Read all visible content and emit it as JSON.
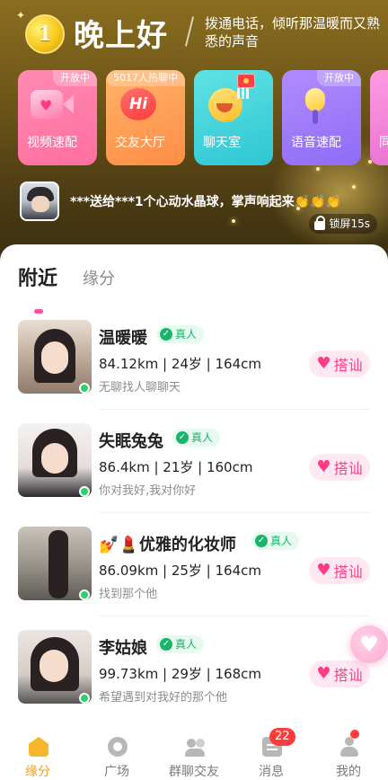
{
  "header": {
    "coin_level": "1",
    "greeting": "晚上好",
    "subtitle": "拨通电话，倾听那温暖而又熟悉的声音"
  },
  "feature_cards": [
    {
      "label": "视频速配",
      "badge": "开放中",
      "icon": "video-camera-heart-icon"
    },
    {
      "label": "交友大厅",
      "badge": "5017人热聊中",
      "icon": "hi-bubble-icon"
    },
    {
      "label": "聊天室",
      "badge": "",
      "icon": "smile-face-icon"
    },
    {
      "label": "语音速配",
      "badge": "开放中",
      "icon": "microphone-icon"
    },
    {
      "label": "同",
      "badge": "",
      "icon": "heart-icon"
    }
  ],
  "gift_marquee": {
    "text": "***送给***1个心动水晶球，掌声响起来👏👏👏"
  },
  "lock_screen": {
    "label": "锁屏15s"
  },
  "tabs": {
    "active": "附近",
    "inactive": "缘分"
  },
  "users": [
    {
      "name": "温暖暖",
      "verified": "真人",
      "stats": "84.12km | 24岁 | 164cm",
      "bio": "无聊找人聊聊天",
      "action": "搭讪",
      "online": true
    },
    {
      "name": "失眠兔兔",
      "verified": "真人",
      "stats": "86.4km | 21岁 | 160cm",
      "bio": "你对我好,我对你好",
      "action": "搭讪",
      "online": true
    },
    {
      "name": "💅💄优雅的化妆师",
      "verified": "真人",
      "stats": "86.09km | 25岁 | 164cm",
      "bio": "找到那个他",
      "action": "搭讪",
      "online": true
    },
    {
      "name": "李姑娘",
      "verified": "真人",
      "stats": "99.73km | 29岁 | 168cm",
      "bio": "希望遇到对我好的那个他",
      "action": "搭讪",
      "online": true
    }
  ],
  "bottom_nav": [
    {
      "label": "缘分",
      "active": true
    },
    {
      "label": "广场",
      "active": false
    },
    {
      "label": "群聊交友",
      "active": false
    },
    {
      "label": "消息",
      "active": false,
      "badge": "22"
    },
    {
      "label": "我的",
      "active": false,
      "dot": true
    }
  ],
  "colors": {
    "accent_pink": "#ff3d86",
    "nav_active": "#f0a21b",
    "verified_green": "#19b46a",
    "online_green": "#2bcf6e",
    "badge_red": "#ff3b3b"
  }
}
